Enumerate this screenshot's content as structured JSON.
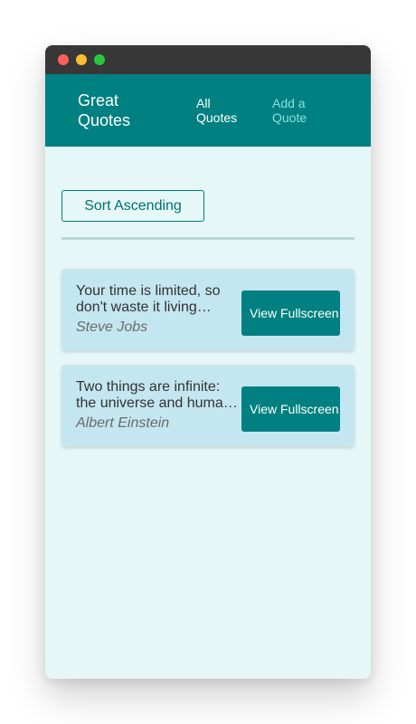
{
  "colors": {
    "titlebar": "#373737",
    "header": "#008080",
    "background": "#e5f7f7",
    "card": "#c4e6f0",
    "accent": "#008080",
    "nav_inactive": "#88e0e0"
  },
  "window_controls": [
    "close",
    "minimize",
    "maximize"
  ],
  "header": {
    "brand": "Great Quotes",
    "nav": [
      {
        "label": "All Quotes",
        "active": true
      },
      {
        "label": "Add a Quote",
        "active": false
      }
    ]
  },
  "main": {
    "sort_button": "Sort Ascending",
    "quotes": [
      {
        "text": "Your time is limited, so don't waste it living someone else's life.",
        "author": "Steve Jobs",
        "button": "View Fullscreen"
      },
      {
        "text": "Two things are infinite: the universe and human stupidity; and I'm not sure about the universe.",
        "author": "Albert Einstein",
        "button": "View Fullscreen"
      }
    ]
  }
}
